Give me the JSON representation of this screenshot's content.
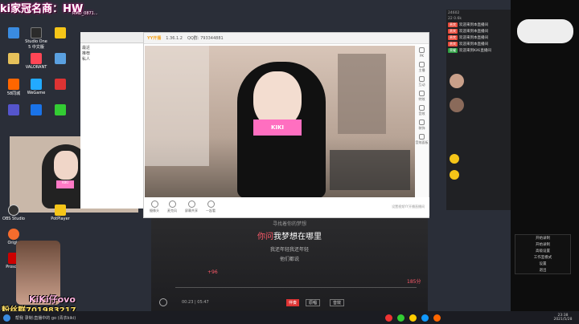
{
  "banner": {
    "title": "ki家冠名商：HW",
    "sub": "RMD_0871..."
  },
  "desktop_icons": [
    {
      "label": "Studio One 5 中文版"
    },
    {
      "label": "PotPlayer"
    },
    {
      "label": "VALORANT"
    },
    {
      "label": "WeGame"
    },
    {
      "label": "58同城"
    },
    {
      "label": "OBS Studio"
    },
    {
      "label": "Origin"
    },
    {
      "label": "Prosche"
    }
  ],
  "yy": {
    "app_name": "YY开播",
    "version": "1.36.1.2",
    "qq": "QQ群: 793344881",
    "topnav": [
      "大明鸟",
      "imelassdk优直播间",
      "黑于谁的"
    ],
    "sidebar": [
      "PK",
      "主播",
      "互动",
      "特效",
      "音效",
      "装饰",
      "音效面板"
    ],
    "tools": [
      "摄像头",
      "麦克风",
      "屏幕共享",
      "一起看"
    ],
    "footer_link": "设置视频YY开播直播间"
  },
  "music": {
    "lyrics": [
      "寻找着你的梦想",
      "你问我梦想在哪里",
      "我还年轻我还年轻",
      "他们都说"
    ],
    "highlight_prefix": "你问",
    "highlight_rest": "我梦想在哪里",
    "time_current": "00:23",
    "time_total": "05:47",
    "score": "+96",
    "count": "185分",
    "btn_accompany": "伴奏",
    "btn_original": "原唱",
    "btn_effect": "音效"
  },
  "overlay": {
    "name1": "KiKi仔ovo",
    "fans": "粉丝群701983217",
    "credit": "帮我 录制:直播中的 go (青衣kiki)"
  },
  "right_menu": [
    "封口",
    "开始录制",
    "开始录制",
    "高级设置",
    "工作室模式",
    "设置",
    "退出"
  ],
  "clock": {
    "time": "23:38",
    "date": "2021/5/28"
  },
  "chat": [
    {
      "tag": "贵宾",
      "text": "欢迎来到本直播间"
    },
    {
      "tag": "贵宾",
      "text": "欢迎来到本直播间"
    },
    {
      "tag": "贵宾",
      "text": "欢迎来到本直播间"
    },
    {
      "tag": "贵宾",
      "text": "欢迎来到本直播间"
    },
    {
      "tag": "荣耀",
      "text": "欢迎来到KiKi直播间"
    }
  ],
  "side_labels": [
    "最近",
    "推荐",
    "私人"
  ],
  "side_counts": [
    "24602",
    "22 0.6k"
  ]
}
